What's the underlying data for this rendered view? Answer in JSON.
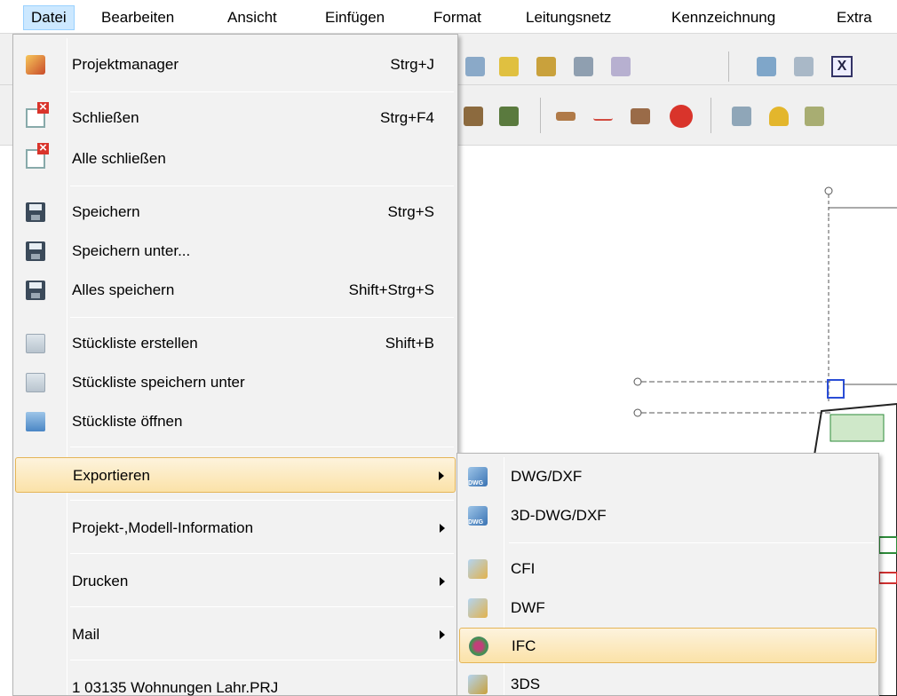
{
  "menubar": {
    "items": [
      "Datei",
      "Bearbeiten",
      "Ansicht",
      "Einfügen",
      "Format",
      "Leitungsnetz",
      "Kennzeichnung",
      "Extra"
    ]
  },
  "file_menu": {
    "items": [
      {
        "label": "Projektmanager",
        "shortcut": "Strg+J",
        "icon": "project-manager-icon"
      },
      {
        "label": "Schließen",
        "shortcut": "Strg+F4",
        "icon": "close-document-icon"
      },
      {
        "label": "Alle schließen",
        "shortcut": "",
        "icon": "close-all-icon"
      },
      {
        "label": "Speichern",
        "shortcut": "Strg+S",
        "icon": "save-icon"
      },
      {
        "label": "Speichern unter...",
        "shortcut": "",
        "icon": "save-as-icon"
      },
      {
        "label": "Alles speichern",
        "shortcut": "Shift+Strg+S",
        "icon": "save-all-icon"
      },
      {
        "label": "Stückliste erstellen",
        "shortcut": "Shift+B",
        "icon": "parts-list-icon"
      },
      {
        "label": "Stückliste speichern unter",
        "shortcut": "",
        "icon": "parts-list-save-icon"
      },
      {
        "label": "Stückliste öffnen",
        "shortcut": "",
        "icon": "parts-list-open-icon"
      },
      {
        "label": "Exportieren",
        "shortcut": "",
        "icon": ""
      },
      {
        "label": "Projekt-,Modell-Information",
        "shortcut": "",
        "icon": ""
      },
      {
        "label": "Drucken",
        "shortcut": "",
        "icon": ""
      },
      {
        "label": "Mail",
        "shortcut": "",
        "icon": ""
      },
      {
        "label": "1 03135 Wohnungen Lahr.PRJ",
        "shortcut": "",
        "icon": ""
      }
    ]
  },
  "export_submenu": {
    "items": [
      {
        "label": "DWG/DXF",
        "icon": "dwg-dxf-icon"
      },
      {
        "label": "3D-DWG/DXF",
        "icon": "3d-dwg-dxf-icon"
      },
      {
        "label": "CFI",
        "icon": "cfi-icon"
      },
      {
        "label": "DWF",
        "icon": "dwf-icon"
      },
      {
        "label": "IFC",
        "icon": "ifc-icon"
      },
      {
        "label": "3DS",
        "icon": "3ds-icon"
      }
    ]
  },
  "colors": {
    "highlight_top": "#fdf3dd",
    "highlight_bottom": "#fbe2a8",
    "highlight_border": "#e4b557",
    "menubar_active": "#cce8ff"
  }
}
